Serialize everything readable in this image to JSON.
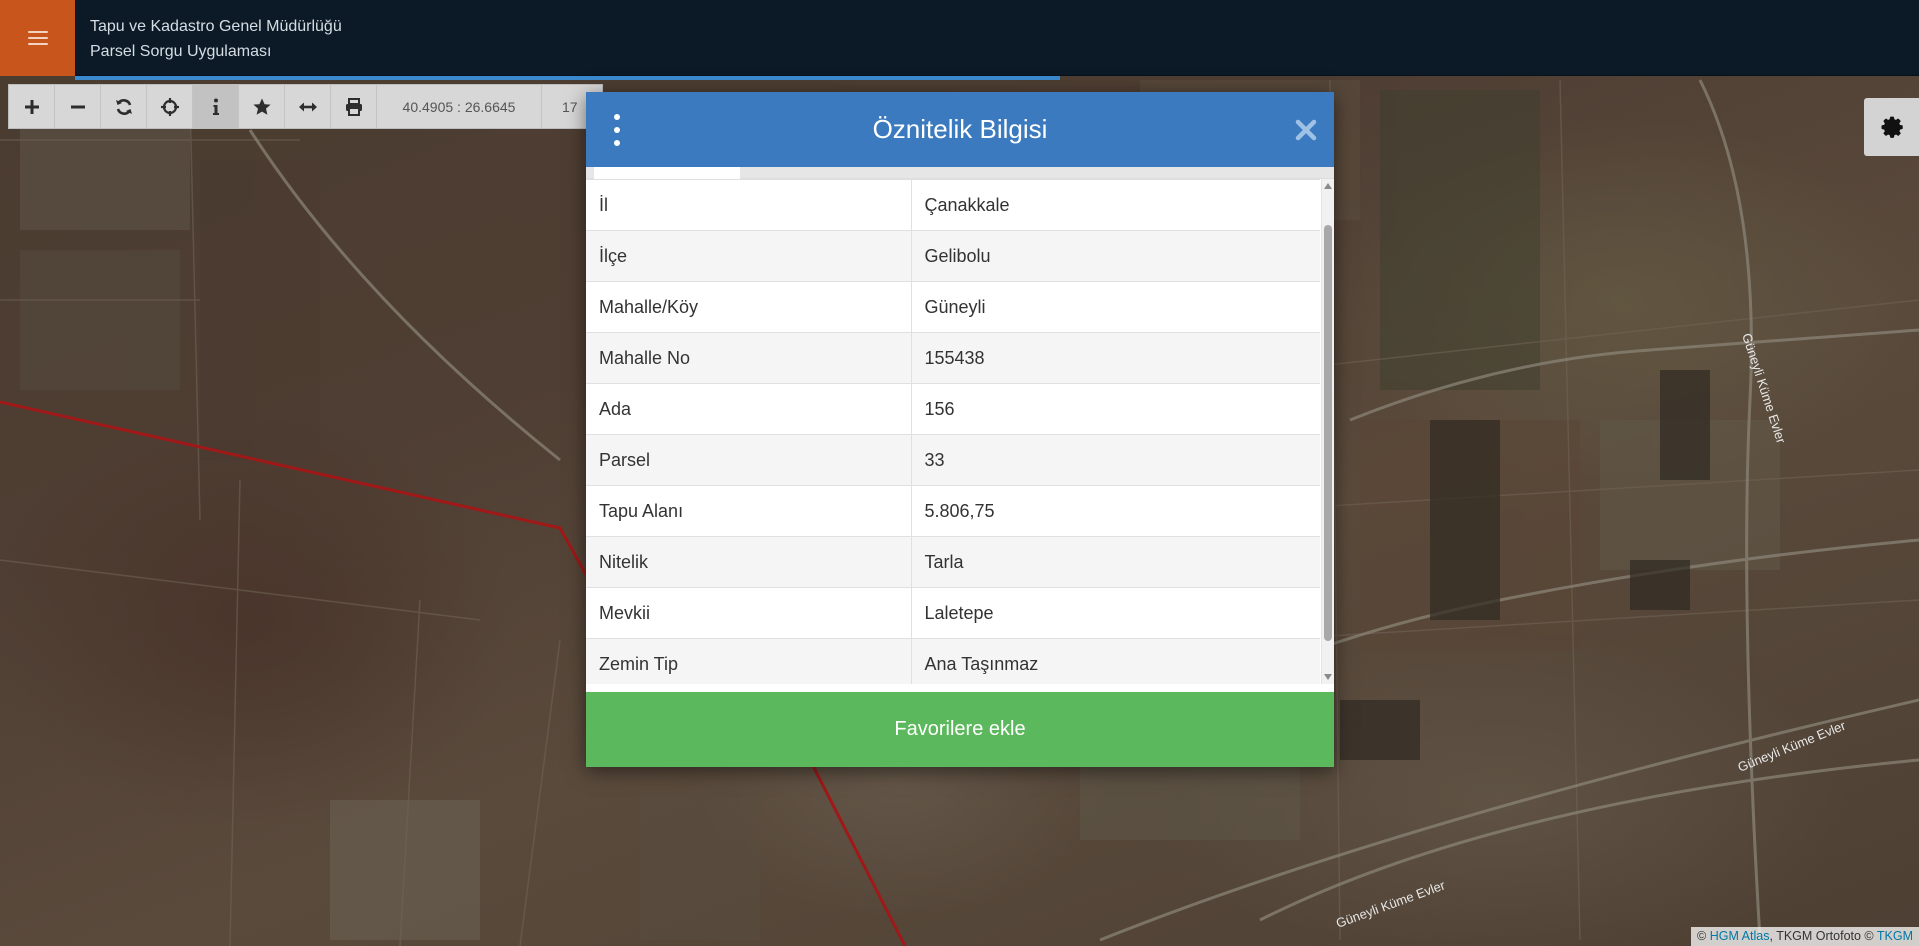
{
  "header": {
    "menu_icon": "hamburger-icon",
    "org_title": "Tapu ve Kadastro Genel Müdürlüğü",
    "app_title": "Parsel Sorgu Uygulaması",
    "accent_color": "#c8561c",
    "background_color": "#0b1a26"
  },
  "toolbar": {
    "buttons": [
      {
        "icon": "zoom-in-icon"
      },
      {
        "icon": "zoom-out-icon"
      },
      {
        "icon": "refresh-icon"
      },
      {
        "icon": "locate-icon"
      },
      {
        "icon": "info-icon",
        "active": true
      },
      {
        "icon": "star-icon"
      },
      {
        "icon": "measure-icon"
      },
      {
        "icon": "print-icon"
      }
    ],
    "coordinates": "40.4905 : 26.6645",
    "zoom_partial": "17"
  },
  "settings": {
    "icon": "gear-icon"
  },
  "map": {
    "labels": [
      "Güneyli Küme Evler",
      "Güneyli Küme Evler",
      "Güneyli Küme Evler"
    ],
    "parcel_line_color": "#a01818"
  },
  "modal": {
    "title": "Öznitelik Bilgisi",
    "header_color": "#3b7abf",
    "more_icon": "more-vertical-icon",
    "close_icon": "close-icon",
    "rows": [
      {
        "key": "İl",
        "value": "Çanakkale"
      },
      {
        "key": "İlçe",
        "value": "Gelibolu"
      },
      {
        "key": "Mahalle/Köy",
        "value": "Güneyli"
      },
      {
        "key": "Mahalle No",
        "value": "155438"
      },
      {
        "key": "Ada",
        "value": "156"
      },
      {
        "key": "Parsel",
        "value": "33"
      },
      {
        "key": "Tapu Alanı",
        "value": "5.806,75"
      },
      {
        "key": "Nitelik",
        "value": "Tarla"
      },
      {
        "key": "Mevkii",
        "value": "Laletepe"
      },
      {
        "key": "Zemin Tip",
        "value": "Ana Taşınmaz"
      }
    ],
    "favorite_button": "Favorilere ekle",
    "favorite_color": "#5cb85c"
  },
  "attribution": {
    "prefix": "©",
    "hgm_link": "HGM Atlas",
    "middle": ", TKGM Ortofoto ©",
    "tkgm_link": "TKGM"
  }
}
